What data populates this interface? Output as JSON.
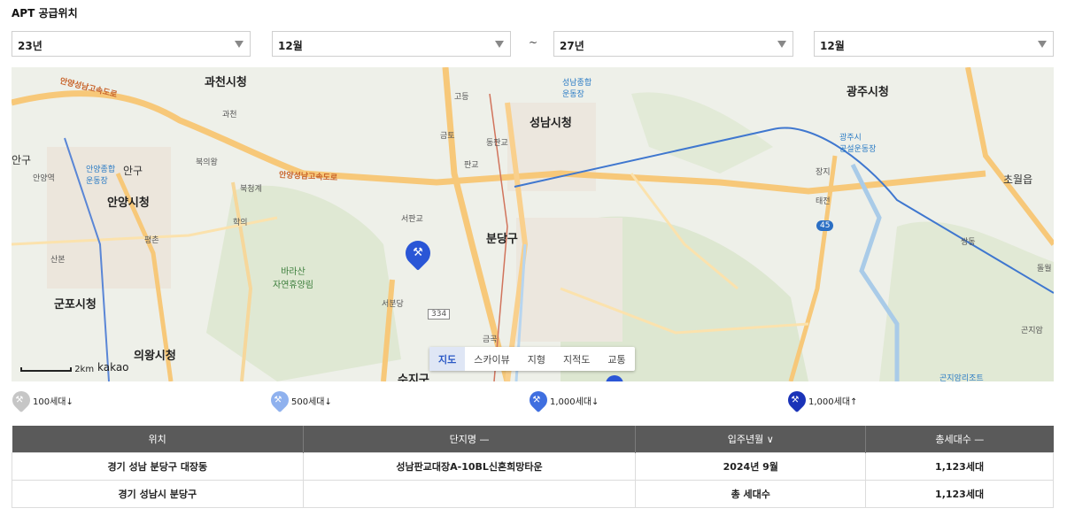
{
  "page": {
    "title": "APT 공급위치"
  },
  "filters": {
    "start_year": "23년",
    "start_month": "12월",
    "separator": "~",
    "end_year": "27년",
    "end_month": "12월"
  },
  "map": {
    "labels": {
      "gwacheon": "과천시청",
      "seongnam": "성남시청",
      "gwangju": "광주시청",
      "anyang": "안양시청",
      "gunpo": "군포시청",
      "uiwang": "의왕시청",
      "bundang": "분당구",
      "sujigu": "수지구",
      "chowol": "초월읍",
      "seopangyo": "서판교",
      "pangyo": "판교",
      "geumto": "금토",
      "dongpangyo": "동판교",
      "godeung": "고등",
      "seobundang": "서분당",
      "geumgok": "금곡",
      "bukuiwang": "북의왕",
      "bukcheonggye": "북청계",
      "hakui": "학의",
      "pyeongchon": "평촌",
      "sanbon": "산본",
      "gwacheon_ic": "과천",
      "anyang_station": "안양역",
      "anyang_gu": "안구",
      "anyang_gu2": "안구",
      "baraesan": "바라산\n자연휴양림",
      "anyang_stadium": "안양종합\n운동장",
      "seongnam_stadium": "성남종합\n운동장",
      "gwangju_stadium": "광주시\n공설운동장",
      "jangji": "장지",
      "taejeon": "태전",
      "ssangdong": "쌍동",
      "gonjiam": "곤지암",
      "gonjiam_resort": "곤지암리조트",
      "dolleul": "돌월",
      "expressway1": "안양성남고속도로",
      "expressway2": "안양성남고속도로",
      "route334": "334",
      "route45": "45"
    },
    "tabs": [
      "지도",
      "스카이뷰",
      "지형",
      "지적도",
      "교통"
    ],
    "active_tab": "지도",
    "scale": "2km",
    "brand": "kakao",
    "pin_color": "#2a56d6"
  },
  "legend": [
    {
      "label": "100세대↓",
      "color": "#c6c6c6"
    },
    {
      "label": "500세대↓",
      "color": "#8fb1ee"
    },
    {
      "label": "1,000세대↓",
      "color": "#3f6fe0"
    },
    {
      "label": "1,000세대↑",
      "color": "#1a33b8"
    }
  ],
  "table": {
    "headers": [
      "위치",
      "단지명 —",
      "입주년월 ∨",
      "총세대수 —"
    ],
    "rows": [
      [
        "경기 성남 분당구 대장동",
        "성남판교대장A-10BL신혼희망타운",
        "2024년 9월",
        "1,123세대"
      ],
      [
        "경기 성남시 분당구",
        "",
        "총 세대수",
        "1,123세대"
      ]
    ]
  }
}
